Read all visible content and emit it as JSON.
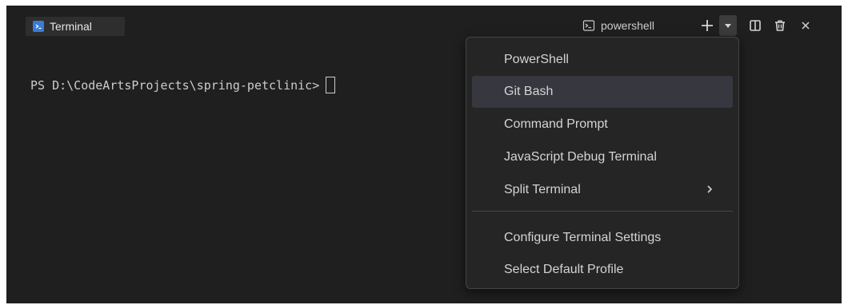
{
  "tab": {
    "label": "Terminal"
  },
  "toolbar": {
    "profile_label": "powershell"
  },
  "terminal": {
    "prompt": "PS D:\\CodeArtsProjects\\spring-petclinic>"
  },
  "menu": {
    "items": [
      {
        "label": "PowerShell"
      },
      {
        "label": "Git Bash"
      },
      {
        "label": "Command Prompt"
      },
      {
        "label": "JavaScript Debug Terminal"
      },
      {
        "label": "Split Terminal"
      },
      {
        "label": "Configure Terminal Settings"
      },
      {
        "label": "Select Default Profile"
      }
    ],
    "highlighted": "Git Bash"
  },
  "colors": {
    "panel_bg": "#1f1f1f",
    "menu_bg": "#252526",
    "highlight_bg": "#37373f",
    "tab_icon": "#3a7bd5",
    "text": "#cccccc"
  }
}
